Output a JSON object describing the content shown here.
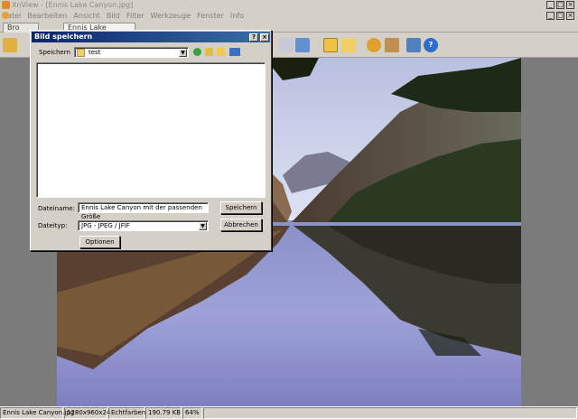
{
  "window": {
    "title": "XnView - [Ennis Lake Canyon.jpg]"
  },
  "menu": [
    "Datei",
    "Bearbeiten",
    "Ansicht",
    "Bild",
    "Filter",
    "Werkzeuge",
    "Fenster",
    "Info"
  ],
  "tabs": {
    "browser": "Bro",
    "image": "Ennis Lake Canyon.jpg"
  },
  "dialog": {
    "title": "Bild speichern",
    "save_in_label": "Speichern",
    "folder": "test",
    "filename_label": "Dateiname:",
    "filename_value": "Ennis Lake Canyon mit der passenden Größe",
    "filetype_label": "Dateityp:",
    "filetype_value": "JPG - JPEG / JFIF",
    "save_button": "Speichern",
    "cancel_button": "Abbrechen",
    "options_button": "Optionen",
    "help_button": "?",
    "close_button": "×"
  },
  "status": [
    "Ennis Lake Canyon.jpg",
    "1280x960x24",
    "Echtfarben",
    "190.79 KB",
    "64%"
  ],
  "colors": {
    "dialog_title_start": "#0a246a",
    "dialog_title_end": "#3a6ea5",
    "viewer_bg": "#7b7b7b"
  }
}
